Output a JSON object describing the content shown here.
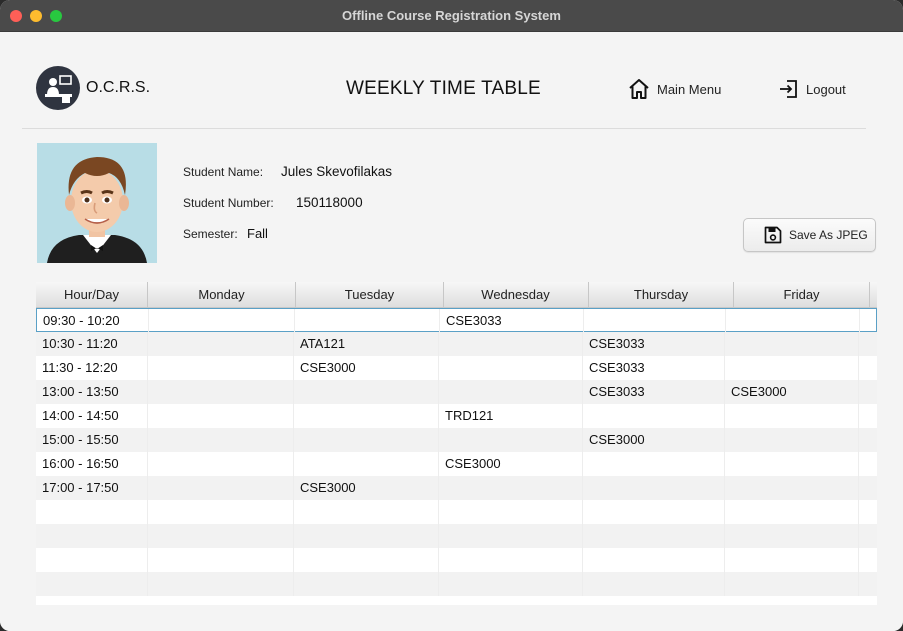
{
  "window": {
    "title": "Offline Course Registration System"
  },
  "header": {
    "logo_text": "O.C.R.S.",
    "page_title": "WEEKLY TIME TABLE",
    "main_menu_label": "Main Menu",
    "logout_label": "Logout"
  },
  "student": {
    "name_label": "Student Name:",
    "name": "Jules Skevofilakas",
    "number_label": "Student Number:",
    "number": "150118000",
    "semester_label": "Semester:",
    "semester": "Fall"
  },
  "save_button": {
    "label": "Save As JPEG"
  },
  "timetable": {
    "columns": [
      "Hour/Day",
      "Monday",
      "Tuesday",
      "Wednesday",
      "Thursday",
      "Friday"
    ],
    "rows": [
      [
        "09:30 - 10:20",
        "",
        "",
        "CSE3033",
        "",
        ""
      ],
      [
        "10:30 - 11:20",
        "",
        "ATA121",
        "",
        "CSE3033",
        ""
      ],
      [
        "11:30 - 12:20",
        "",
        "CSE3000",
        "",
        "CSE3033",
        ""
      ],
      [
        "13:00 - 13:50",
        "",
        "",
        "",
        "CSE3033",
        "CSE3000"
      ],
      [
        "14:00 - 14:50",
        "",
        "",
        "TRD121",
        "",
        ""
      ],
      [
        "15:00 - 15:50",
        "",
        "",
        "",
        "CSE3000",
        ""
      ],
      [
        "16:00 - 16:50",
        "",
        "",
        "CSE3000",
        "",
        ""
      ],
      [
        "17:00 - 17:50",
        "",
        "CSE3000",
        "",
        "",
        ""
      ],
      [
        "",
        "",
        "",
        "",
        "",
        ""
      ],
      [
        "",
        "",
        "",
        "",
        "",
        ""
      ],
      [
        "",
        "",
        "",
        "",
        "",
        ""
      ],
      [
        "",
        "",
        "",
        "",
        "",
        ""
      ]
    ],
    "selected_row": 0
  }
}
